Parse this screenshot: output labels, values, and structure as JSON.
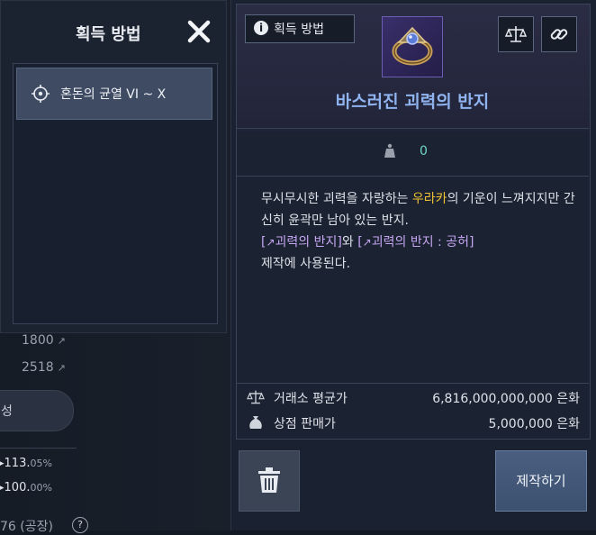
{
  "acquisition_panel": {
    "title": "획득 방법",
    "items": [
      {
        "label": "혼돈의 균열 VI ~ X"
      }
    ]
  },
  "background_page": {
    "value_1": "1800",
    "value_2": "2518",
    "button_label": "성",
    "stat_1": "113.",
    "stat_1_suffix": "05%",
    "stat_2": "100.",
    "stat_2_suffix": "00%",
    "footer_text": "76 (공장)",
    "help_glyph": "?"
  },
  "item_tooltip": {
    "acquire_chip_label": "획득 방법",
    "info_glyph": "i",
    "name": "바스러진 괴력의 반지",
    "weight_value": "0",
    "description": {
      "part1": "무시무시한 괴력을 자랑하는 ",
      "highlight": "우라카",
      "part2": "의 기운이 느껴지지만 간신히 윤곽만 남아 있는 반지.",
      "link1": "괴력의 반지",
      "conj": "와 ",
      "link2": "괴력의 반지 : 공허",
      "part3": "제작에 사용된다."
    },
    "market_price_label": "거래소 평균가",
    "market_price_value": "6,816,000,000,000 은화",
    "shop_price_label": "상점 판매가",
    "shop_price_value": "5,000,000 은화",
    "craft_button_label": "제작하기"
  },
  "colors": {
    "item_name": "#8fb4f0",
    "highlight_yellow": "#f0c233",
    "link_purple": "#c7a7f3",
    "weight_teal": "#6fd7c4"
  },
  "icons": {
    "close": "close-icon",
    "compass": "compass-icon",
    "scale": "scale-icon",
    "link": "link-icon",
    "weight": "weight-icon",
    "coin_bag": "coin-bag-icon",
    "trash": "trash-icon",
    "external": "external-link-icon"
  }
}
